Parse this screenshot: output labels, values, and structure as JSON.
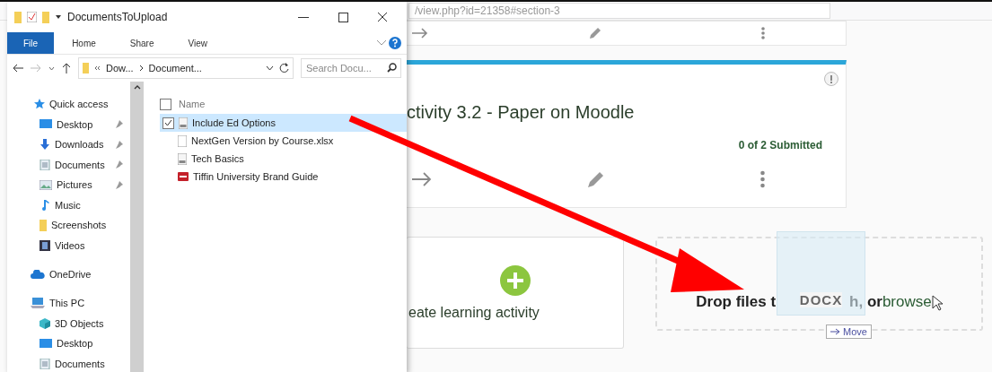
{
  "browser": {
    "address": "/view.php?id=21358#section-3",
    "activity": {
      "title": "ctivity 3.2 - Paper on Moodle",
      "status": "0 of 2 Submitted"
    },
    "create_tile": {
      "label": "eate learning activity"
    },
    "drop_zone": {
      "before": "Drop files t",
      "after": "h, or ",
      "link": "browse"
    },
    "drag_ghost": {
      "label": "DOCX",
      "tooltip": "Move"
    }
  },
  "explorer": {
    "title": "DocumentsToUpload",
    "tabs": [
      {
        "label": "File",
        "selected": true
      },
      {
        "label": "Home",
        "selected": false
      },
      {
        "label": "Share",
        "selected": false
      },
      {
        "label": "View",
        "selected": false
      }
    ],
    "path": [
      "Dow...",
      "Document..."
    ],
    "search": {
      "placeholder": "Search Docu..."
    },
    "nav": [
      {
        "label": "Quick access",
        "kind": "star",
        "children": [
          {
            "label": "Desktop",
            "kind": "desktop",
            "pinned": true
          },
          {
            "label": "Downloads",
            "kind": "download",
            "pinned": true
          },
          {
            "label": "Documents",
            "kind": "doc",
            "pinned": true
          },
          {
            "label": "Pictures",
            "kind": "pictures",
            "pinned": true
          },
          {
            "label": "Music",
            "kind": "music",
            "pinned": false
          },
          {
            "label": "Screenshots",
            "kind": "folder",
            "pinned": false
          },
          {
            "label": "Videos",
            "kind": "videos",
            "pinned": false
          }
        ]
      },
      {
        "label": "OneDrive",
        "kind": "cloud"
      },
      {
        "label": "This PC",
        "kind": "pc",
        "children": [
          {
            "label": "3D Objects",
            "kind": "cube",
            "pinned": false
          },
          {
            "label": "Desktop",
            "kind": "desktop",
            "pinned": false
          },
          {
            "label": "Documents",
            "kind": "doc",
            "pinned": false
          }
        ]
      }
    ],
    "column": {
      "label": "Name",
      "checked": false
    },
    "files": [
      {
        "name": "Include Ed Options",
        "kind": "docx",
        "selected": true
      },
      {
        "name": "NextGen Version by Course.xlsx",
        "kind": "blank",
        "selected": false
      },
      {
        "name": "Tech Basics",
        "kind": "docx",
        "selected": false
      },
      {
        "name": "Tiffin University Brand Guide",
        "kind": "pdf",
        "selected": false
      }
    ]
  }
}
